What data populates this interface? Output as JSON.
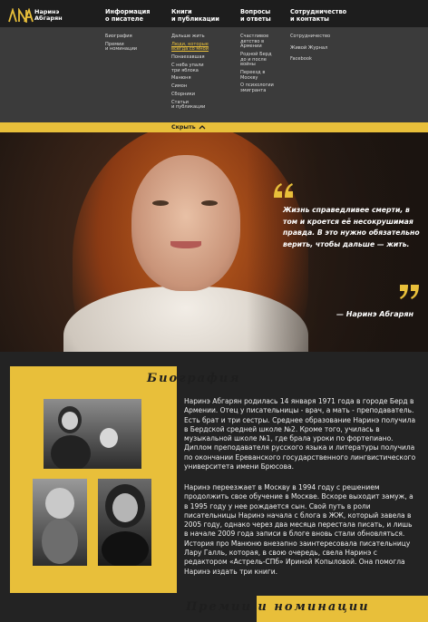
{
  "logo": {
    "text": "Наринэ\nАбгарян",
    "icon": "na-monogram"
  },
  "nav": [
    {
      "label": "Информация\nо писателе"
    },
    {
      "label": "Книги\nи публикации"
    },
    {
      "label": "Вопросы\nи ответы"
    },
    {
      "label": "Сотрудничество\nи контакты"
    }
  ],
  "menu": {
    "about": [
      "Биография",
      "Премии\nи номинации"
    ],
    "books": [
      "Дальше жить",
      "Люди, которые\nвсегда со мной",
      "Понаехавшая",
      "С неба упали\nтри яблока",
      "Манюня",
      "Симон",
      "Сборники",
      "Статьи\nи публикации"
    ],
    "qa": [
      "Счастливое\nдетство в\nАрмении",
      "Родной Берд\nдо и после\nвойны",
      "Переезд в\nМоскву",
      "О психологии\nэмигранта"
    ],
    "contacts": [
      "Сотрудничество",
      "Живой Журнал",
      "Facebook"
    ],
    "active_item": "Люди, которые\nвсегда со мной"
  },
  "hide_button": {
    "label": "Скрыть",
    "icon": "chevron-up-icon"
  },
  "hero": {
    "quote": "Жизнь справедливее смерти, в том и кроется её несокрушимая правда. В это нужно обязательно верить, чтобы дальше — жить.",
    "author": "— Наринэ Абгарян"
  },
  "biography": {
    "title": "Биография",
    "p1": "Наринэ Абгарян родилась 14 января 1971 года в городе Берд в Армении. Отец у писательницы - врач, а мать - преподаватель. Есть брат и три сестры. Среднее образование Наринэ получила в Бердской средней школе №2. Кроме того, училась в музыкальной школе №1, где брала уроки по фортепиано. Диплом преподавателя русского языка и литературы получила по окончании Ереванского государственного лингвистического университета имени Брюсова.",
    "p2": "Наринэ переезжает в Москву в 1994 году с решением продолжить свое обучение в Москве. Вскоре выходит замуж, а в 1995 году у нее рождается сын. Свой путь в роли писательницы Наринэ начала с блога в ЖЖ, который завела в 2005 году, однако через два месяца перестала писать, и лишь в начале 2009 года записи в блоге вновь стали обновляться. История про Манюню внезапно заинтересовала писательницу Лару Галль, которая, в свою очередь, свела Наринэ с редактором «Астрель-СПб» Ириной Копыловой. Она помогла Наринэ издать три книги."
  },
  "awards": {
    "title": "Премии и номинации"
  },
  "colors": {
    "accent": "#e8bf3a",
    "dark": "#1d1d1d",
    "panel": "#3b3b3b"
  }
}
